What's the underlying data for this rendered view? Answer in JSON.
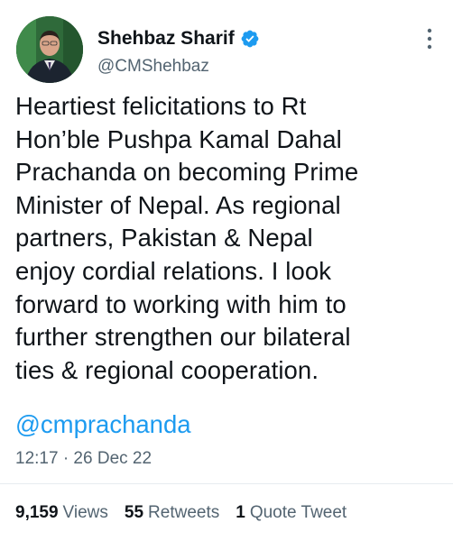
{
  "author": {
    "display_name": "Shehbaz Sharif",
    "handle": "@CMShehbaz",
    "verified": true
  },
  "tweet": {
    "text": "Heartiest felicitations to Rt\nHon’ble Pushpa Kamal Dahal\nPrachanda on becoming Prime\nMinister of Nepal. As regional\npartners, Pakistan & Nepal\nenjoy cordial relations. I look\nforward to working with him to\nfurther strengthen our bilateral\nties & regional cooperation.",
    "mention": "@cmprachanda",
    "timestamp": "12:17 · 26 Dec 22"
  },
  "stats": {
    "views_count": "9,159",
    "views_label": "Views",
    "retweets_count": "55",
    "retweets_label": "Retweets",
    "quotes_count": "1",
    "quotes_label": "Quote Tweet"
  },
  "colors": {
    "link": "#1d9bf0",
    "secondary_text": "#536471",
    "verified_badge": "#1d9bf0"
  },
  "icons": {
    "verified": "verified-badge-icon",
    "more": "more-options-icon"
  }
}
